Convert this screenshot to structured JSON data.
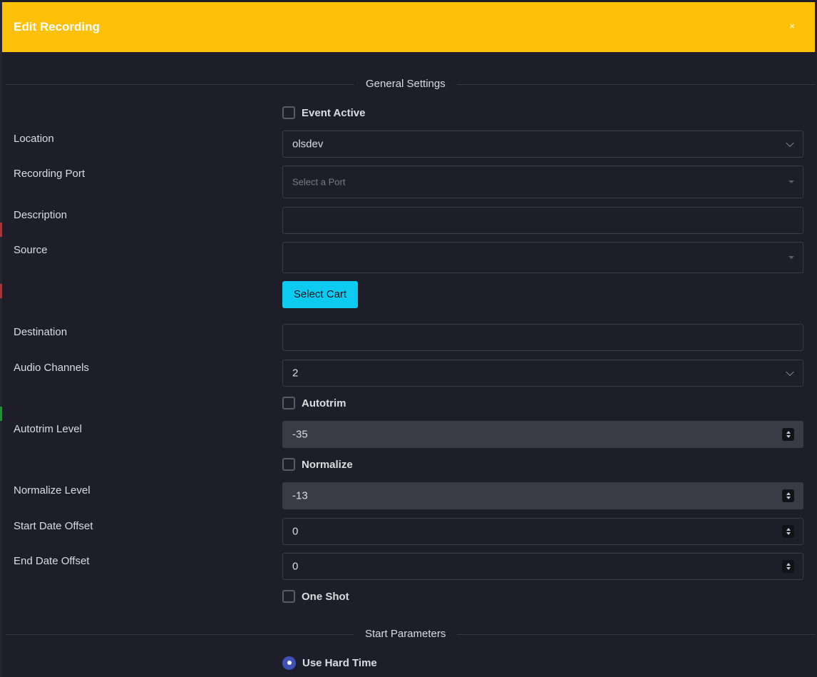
{
  "modal": {
    "title": "Edit Recording",
    "close_label": "×"
  },
  "sections": {
    "general": "General Settings",
    "start": "Start Parameters"
  },
  "form": {
    "event_active": {
      "label": "Event Active",
      "checked": false
    },
    "location": {
      "label": "Location",
      "value": "olsdev"
    },
    "recording_port": {
      "label": "Recording Port",
      "placeholder": "Select a Port"
    },
    "description": {
      "label": "Description",
      "value": ""
    },
    "source": {
      "label": "Source",
      "value": ""
    },
    "select_cart_label": "Select Cart",
    "destination": {
      "label": "Destination",
      "value": ""
    },
    "audio_channels": {
      "label": "Audio Channels",
      "value": "2"
    },
    "autotrim": {
      "label": "Autotrim",
      "checked": false
    },
    "autotrim_level": {
      "label": "Autotrim Level",
      "value": "-35"
    },
    "normalize": {
      "label": "Normalize",
      "checked": false
    },
    "normalize_level": {
      "label": "Normalize Level",
      "value": "-13"
    },
    "start_date_offset": {
      "label": "Start Date Offset",
      "value": "0"
    },
    "end_date_offset": {
      "label": "End Date Offset",
      "value": "0"
    },
    "one_shot": {
      "label": "One Shot",
      "checked": false
    },
    "use_hard_time": {
      "label": "Use Hard Time",
      "selected": true
    }
  },
  "colors": {
    "header": "#ffc107",
    "accent_button": "#0dcaf0",
    "radio": "#3f51b5",
    "background": "#1e1e2a"
  }
}
